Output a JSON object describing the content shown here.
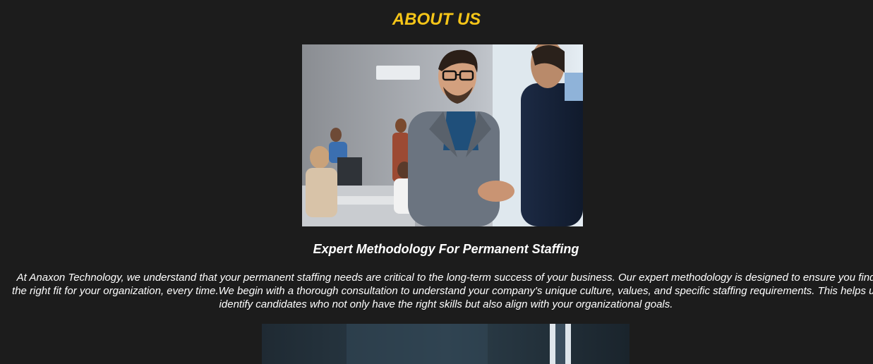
{
  "about": {
    "title": "ABOUT US",
    "image_alt": "handshake-photo"
  },
  "section": {
    "heading": "Expert Methodology For Permanent Staffing",
    "paragraph": "At Anaxon Technology, we understand that your permanent staffing needs are critical to the long-term success of your business. Our expert methodology is designed to ensure you find the right fit for your organization, every time.We begin with a thorough consultation to understand your company's unique culture, values, and specific staffing requirements. This helps us identify candidates who not only have the right skills but also align with your organizational goals."
  },
  "colors": {
    "background": "#1c1c1c",
    "accent": "#f5c518",
    "text": "#ffffff"
  }
}
